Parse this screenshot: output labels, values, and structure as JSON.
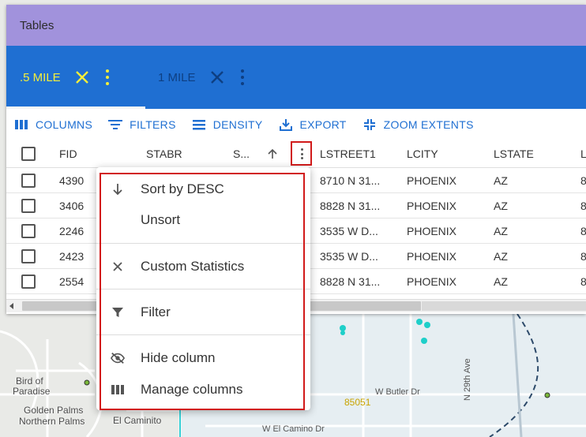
{
  "window": {
    "title": "Tables"
  },
  "tabs": [
    {
      "label": ".5 MILE",
      "active": true
    },
    {
      "label": "1 MILE",
      "active": false
    }
  ],
  "toolbar": {
    "columns_label": "COLUMNS",
    "filters_label": "FILTERS",
    "density_label": "DENSITY",
    "export_label": "EXPORT",
    "zoom_label": "ZOOM EXTENTS"
  },
  "table": {
    "columns": [
      "FID",
      "STABR",
      "S...",
      "LSTREET1",
      "LCITY",
      "LSTATE",
      "L"
    ],
    "rows": [
      {
        "fid": "4390",
        "lstreet1": "8710 N 31...",
        "lcity": "PHOENIX",
        "lstate": "AZ",
        "next": "8"
      },
      {
        "fid": "3406",
        "lstreet1": "8828 N 31...",
        "lcity": "PHOENIX",
        "lstate": "AZ",
        "next": "8"
      },
      {
        "fid": "2246",
        "lstreet1": "3535 W D...",
        "lcity": "PHOENIX",
        "lstate": "AZ",
        "next": "8"
      },
      {
        "fid": "2423",
        "lstreet1": "3535 W D...",
        "lcity": "PHOENIX",
        "lstate": "AZ",
        "next": "8"
      },
      {
        "fid": "2554",
        "lstreet1": "8828 N 31...",
        "lcity": "PHOENIX",
        "lstate": "AZ",
        "next": "8"
      }
    ]
  },
  "column_menu": {
    "sort_desc": "Sort by DESC",
    "unsort": "Unsort",
    "custom_stats": "Custom Statistics",
    "filter": "Filter",
    "hide_column": "Hide column",
    "manage_columns": "Manage columns"
  },
  "map": {
    "labels": [
      "Bird of",
      "Paradise",
      "Golden Palms",
      "Northern Palms",
      "El Caminito"
    ],
    "zip": "85051",
    "streets": [
      "W Butler Dr",
      "W El Camino Dr",
      "N 29th Ave"
    ]
  },
  "colors": {
    "title_bar": "#a192dc",
    "tab_bar": "#1f6fd2",
    "active_tab": "#f5ef3a",
    "accent": "#1f6fd2",
    "highlight": "#d11a1a"
  }
}
